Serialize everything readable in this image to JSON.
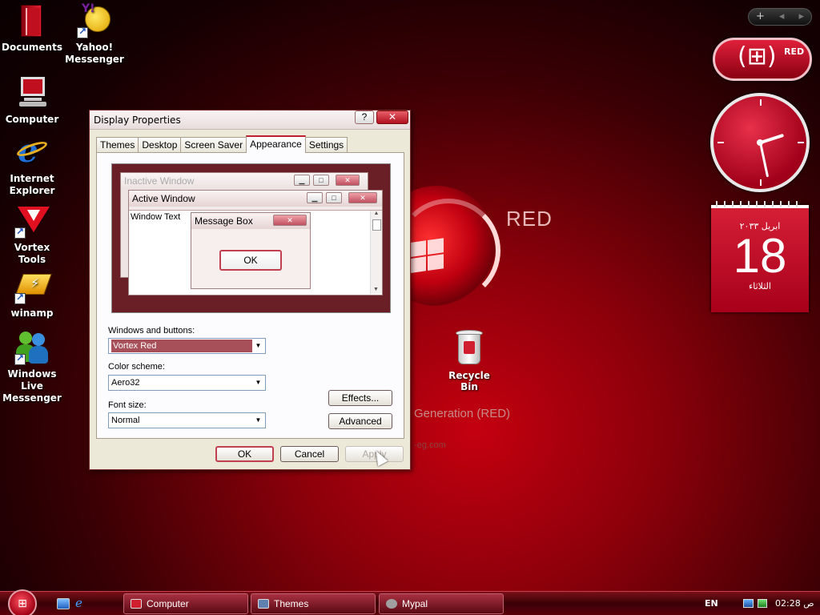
{
  "desktop": {
    "icons": [
      {
        "label": "Documents",
        "icon": "documents-folder-icon"
      },
      {
        "label": "Yahoo! Messenger",
        "icon": "yahoo-messenger-icon"
      },
      {
        "label": "Computer",
        "icon": "computer-icon"
      },
      {
        "label": "Internet Explorer",
        "icon": "internet-explorer-icon"
      },
      {
        "label": "Vortex Tools",
        "icon": "vortex-tools-icon"
      },
      {
        "label": "winamp",
        "icon": "winamp-icon"
      },
      {
        "label": "Windows Live Messenger",
        "icon": "windows-live-messenger-icon"
      },
      {
        "label": "Recycle Bin",
        "icon": "recycle-bin-icon"
      }
    ],
    "wallpaper": {
      "brand_text": "RED",
      "generation_text": "Generation (RED)",
      "url_text": "-eg.com"
    }
  },
  "gadgets": {
    "sidebar_controls": {
      "add": "+",
      "prev": "◂",
      "next": "▸"
    },
    "red_badge_label": "RED",
    "calendar": {
      "month_year": "ابريل ٢٠٣٣",
      "day": "18",
      "weekday": "الثلاثاء"
    }
  },
  "dialog": {
    "title": "Display Properties",
    "help_button": "?",
    "close_button": "✕",
    "tabs": [
      {
        "label": "Themes",
        "active": false
      },
      {
        "label": "Desktop",
        "active": false
      },
      {
        "label": "Screen Saver",
        "active": false
      },
      {
        "label": "Appearance",
        "active": true
      },
      {
        "label": "Settings",
        "active": false
      }
    ],
    "preview": {
      "inactive_window_title": "Inactive Window",
      "active_window_title": "Active Window",
      "window_text": "Window Text",
      "message_box_title": "Message Box",
      "message_box_ok": "OK"
    },
    "fields": {
      "windows_and_buttons": {
        "label": "Windows and buttons:",
        "value": "Vortex Red"
      },
      "color_scheme": {
        "label": "Color scheme:",
        "value": "Aero32"
      },
      "font_size": {
        "label": "Font size:",
        "value": "Normal"
      }
    },
    "buttons": {
      "effects": "Effects...",
      "advanced": "Advanced",
      "ok": "OK",
      "cancel": "Cancel",
      "apply": "Apply"
    }
  },
  "taskbar": {
    "tasks": [
      {
        "label": "Computer",
        "icon": "computer-icon"
      },
      {
        "label": "Themes",
        "icon": "themes-icon"
      },
      {
        "label": "Mypal",
        "icon": "mypal-icon"
      }
    ],
    "language": "EN",
    "clock": "02:28 ص"
  },
  "colors": {
    "accent": "#c02030",
    "taskbar": "#5a000a",
    "dialog_face": "#ece9d8"
  }
}
